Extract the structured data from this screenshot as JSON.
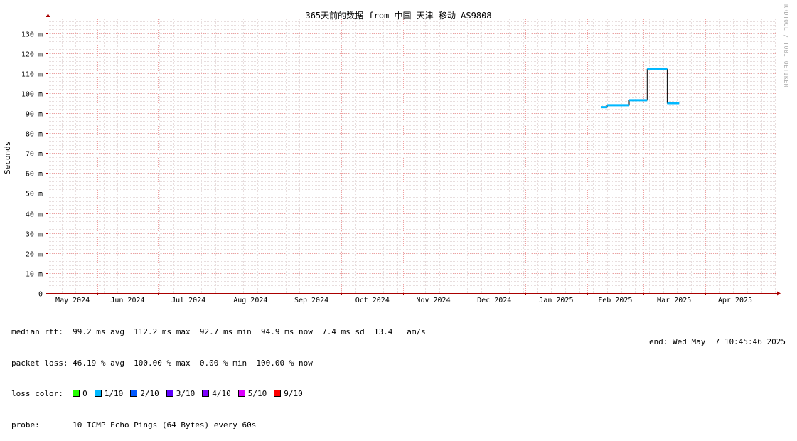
{
  "title": "365天前的数据 from 中国 天津 移动 AS9808",
  "watermark": "RRDTOOL / TOBI OETIKER",
  "stats": {
    "median_rtt": "median rtt:  99.2 ms avg  112.2 ms max  92.7 ms min  94.9 ms now  7.4 ms sd  13.4   am/s",
    "packet_loss": "packet loss: 46.19 % avg  100.00 % max  0.00 % min  100.00 % now",
    "loss_color_label": "loss color:",
    "probe": "probe:       10 ICMP Echo Pings (64 Bytes) every 60s",
    "end": "end: Wed May  7 10:45:46 2025"
  },
  "loss_legend": [
    {
      "label": "0",
      "color": "#26ff00"
    },
    {
      "label": "1/10",
      "color": "#00b8ff"
    },
    {
      "label": "2/10",
      "color": "#0059ff"
    },
    {
      "label": "3/10",
      "color": "#5e00ff"
    },
    {
      "label": "4/10",
      "color": "#7e00ff"
    },
    {
      "label": "5/10",
      "color": "#dd00ff"
    },
    {
      "label": "9/10",
      "color": "#ff0000"
    }
  ],
  "chart_data": {
    "type": "line",
    "title": "365天前的数据 from 中国 天津 移动 AS9808",
    "ylabel": "Seconds",
    "xlabel": "",
    "ylim": [
      0,
      0.137
    ],
    "yticks": [
      {
        "v": 0,
        "label": "0"
      },
      {
        "v": 0.01,
        "label": "10 m"
      },
      {
        "v": 0.02,
        "label": "20 m"
      },
      {
        "v": 0.03,
        "label": "30 m"
      },
      {
        "v": 0.04,
        "label": "40 m"
      },
      {
        "v": 0.05,
        "label": "50 m"
      },
      {
        "v": 0.06,
        "label": "60 m"
      },
      {
        "v": 0.07,
        "label": "70 m"
      },
      {
        "v": 0.08,
        "label": "80 m"
      },
      {
        "v": 0.09,
        "label": "90 m"
      },
      {
        "v": 0.1,
        "label": "100 m"
      },
      {
        "v": 0.11,
        "label": "110 m"
      },
      {
        "v": 0.12,
        "label": "120 m"
      },
      {
        "v": 0.13,
        "label": "130 m"
      }
    ],
    "xlim": [
      "2024-05-07",
      "2025-05-07"
    ],
    "months": [
      {
        "date": "2024-05-01",
        "label": "May 2024"
      },
      {
        "date": "2024-06-01",
        "label": "Jun 2024"
      },
      {
        "date": "2024-07-01",
        "label": "Jul 2024"
      },
      {
        "date": "2024-08-01",
        "label": "Aug 2024"
      },
      {
        "date": "2024-09-01",
        "label": "Sep 2024"
      },
      {
        "date": "2024-10-01",
        "label": "Oct 2024"
      },
      {
        "date": "2024-11-01",
        "label": "Nov 2024"
      },
      {
        "date": "2024-12-01",
        "label": "Dec 2024"
      },
      {
        "date": "2025-01-01",
        "label": "Jan 2025"
      },
      {
        "date": "2025-02-01",
        "label": "Feb 2025"
      },
      {
        "date": "2025-03-01",
        "label": "Mar 2025"
      },
      {
        "date": "2025-04-01",
        "label": "Apr 2025"
      }
    ],
    "series": [
      {
        "color": "#00b8ff",
        "points": [
          [
            "2025-02-08",
            0.093
          ],
          [
            "2025-02-11",
            0.093
          ],
          [
            "2025-02-11",
            0.094
          ],
          [
            "2025-02-22",
            0.094
          ],
          [
            "2025-02-22",
            0.0965
          ],
          [
            "2025-03-03",
            0.0965
          ],
          [
            "2025-03-03",
            0.112
          ],
          [
            "2025-03-13",
            0.112
          ],
          [
            "2025-03-13",
            0.095
          ],
          [
            "2025-03-19",
            0.095
          ]
        ]
      }
    ]
  }
}
